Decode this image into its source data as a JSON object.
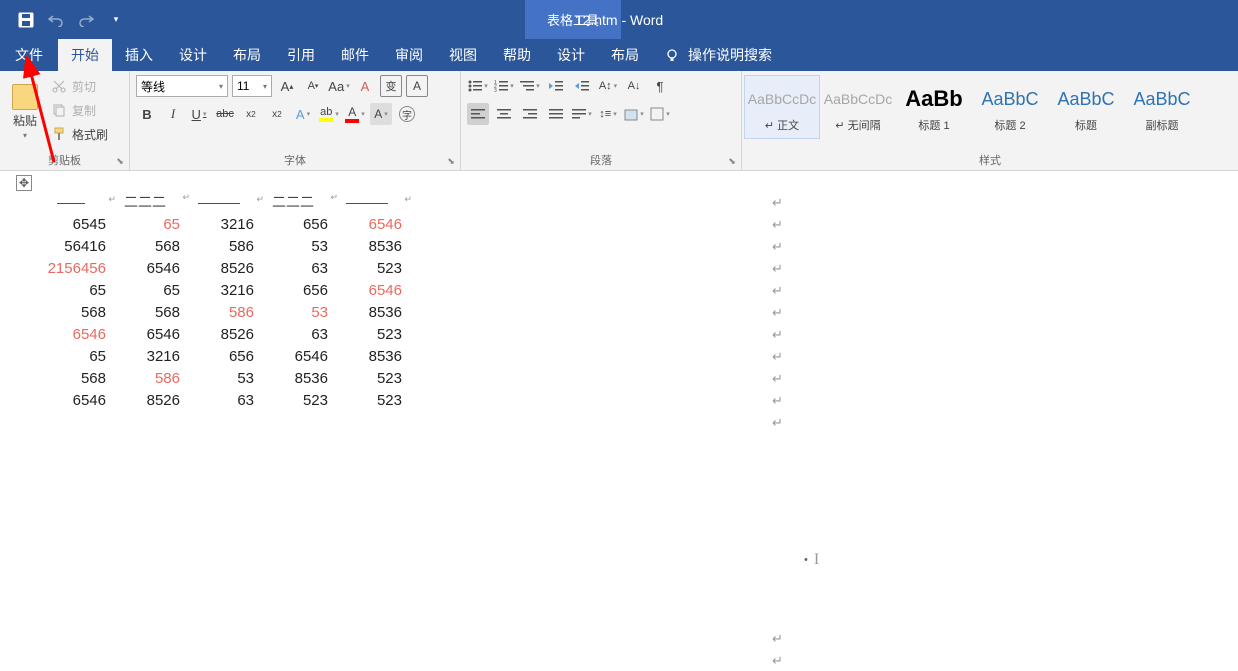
{
  "title": {
    "toolTab": "表格工具",
    "docName": "12.htm - Word"
  },
  "qat": {
    "save": "save",
    "undo": "undo",
    "redo": "redo",
    "more": "more"
  },
  "tabs": {
    "file": "文件",
    "home": "开始",
    "insert": "插入",
    "design1": "设计",
    "layout1": "布局",
    "references": "引用",
    "mailings": "邮件",
    "review": "审阅",
    "view": "视图",
    "help": "帮助",
    "design2": "设计",
    "layout2": "布局",
    "tellMe": "操作说明搜索"
  },
  "clipboard": {
    "paste": "粘贴",
    "cut": "剪切",
    "copy": "复制",
    "formatPainter": "格式刷",
    "label": "剪贴板"
  },
  "font": {
    "name": "等线",
    "size": "11",
    "label": "字体"
  },
  "paragraph": {
    "label": "段落"
  },
  "styles": {
    "label": "样式",
    "items": [
      {
        "preview": "AaBbCcDc",
        "name": "↵ 正文",
        "class": "gray",
        "selected": true
      },
      {
        "preview": "AaBbCcDc",
        "name": "↵ 无间隔",
        "class": "gray",
        "selected": false
      },
      {
        "preview": "AaBb",
        "name": "标题 1",
        "class": "big",
        "selected": false
      },
      {
        "preview": "AaBbC",
        "name": "标题 2",
        "class": "blue",
        "selected": false
      },
      {
        "preview": "AaBbC",
        "name": "标题",
        "class": "blue",
        "selected": false
      },
      {
        "preview": "AaBbC",
        "name": "副标题",
        "class": "blue",
        "selected": false
      }
    ]
  },
  "table": {
    "headers": [
      "——",
      "二二二",
      "———",
      "二二二",
      "———"
    ],
    "rows": [
      [
        {
          "v": "6545"
        },
        {
          "v": "65",
          "red": true
        },
        {
          "v": "3216"
        },
        {
          "v": "656"
        },
        {
          "v": "6546",
          "red": true
        }
      ],
      [
        {
          "v": "56416"
        },
        {
          "v": "568"
        },
        {
          "v": "586"
        },
        {
          "v": "53"
        },
        {
          "v": "8536"
        }
      ],
      [
        {
          "v": "2156456",
          "red": true
        },
        {
          "v": "6546"
        },
        {
          "v": "8526"
        },
        {
          "v": "63"
        },
        {
          "v": "523"
        }
      ],
      [
        {
          "v": "65"
        },
        {
          "v": "65"
        },
        {
          "v": "3216"
        },
        {
          "v": "656"
        },
        {
          "v": "6546",
          "red": true
        }
      ],
      [
        {
          "v": "568"
        },
        {
          "v": "568"
        },
        {
          "v": "586",
          "red": true
        },
        {
          "v": "53",
          "red": true
        },
        {
          "v": "8536"
        }
      ],
      [
        {
          "v": "6546",
          "red": true
        },
        {
          "v": "6546"
        },
        {
          "v": "8526"
        },
        {
          "v": "63"
        },
        {
          "v": "523"
        }
      ],
      [
        {
          "v": "65"
        },
        {
          "v": "3216"
        },
        {
          "v": "656"
        },
        {
          "v": "6546"
        },
        {
          "v": "8536"
        }
      ],
      [
        {
          "v": "568"
        },
        {
          "v": "586",
          "red": true
        },
        {
          "v": "53"
        },
        {
          "v": "8536"
        },
        {
          "v": "523"
        }
      ],
      [
        {
          "v": "6546"
        },
        {
          "v": "8526"
        },
        {
          "v": "63"
        },
        {
          "v": "523"
        },
        {
          "v": "523"
        }
      ]
    ]
  },
  "chart_data": {
    "type": "table",
    "headers": [
      "——",
      "二二二",
      "———",
      "二二二",
      "———"
    ],
    "rows": [
      [
        6545,
        65,
        3216,
        656,
        6546
      ],
      [
        56416,
        568,
        586,
        53,
        8536
      ],
      [
        2156456,
        6546,
        8526,
        63,
        523
      ],
      [
        65,
        65,
        3216,
        656,
        6546
      ],
      [
        568,
        568,
        586,
        53,
        8536
      ],
      [
        6546,
        6546,
        8526,
        63,
        523
      ],
      [
        65,
        3216,
        656,
        6546,
        8536
      ],
      [
        568,
        586,
        53,
        8536,
        523
      ],
      [
        6546,
        8526,
        63,
        523,
        523
      ]
    ],
    "highlighted_cells": [
      [
        0,
        1
      ],
      [
        0,
        4
      ],
      [
        2,
        0
      ],
      [
        3,
        4
      ],
      [
        4,
        2
      ],
      [
        4,
        3
      ],
      [
        5,
        0
      ],
      [
        7,
        1
      ]
    ]
  }
}
